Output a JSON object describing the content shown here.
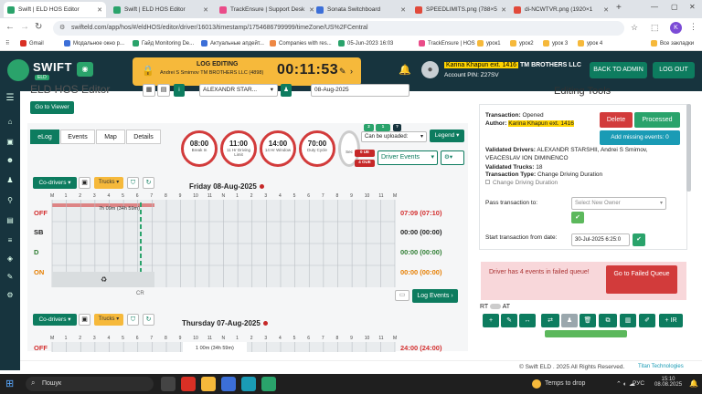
{
  "browser": {
    "tabs": [
      {
        "title": "Swift | ELD HOS Editor",
        "color": "#2aa36b"
      },
      {
        "title": "Swift | ELD HOS Editor",
        "color": "#2aa36b"
      },
      {
        "title": "TrackEnsure | Support Desk",
        "color": "#ea4c89"
      },
      {
        "title": "Sonata Switchboard",
        "color": "#3c6fd8"
      },
      {
        "title": "SPEEDLIMITS.png (788×5",
        "color": "#e14a3b"
      },
      {
        "title": "di-NCWTVR.png (1920×1",
        "color": "#e14a3b"
      }
    ],
    "url": "swifteld.com/app/hos/#/eldHOS/editor/driver/16013/timestamp/1754686799999/timeZone/US%2FCentral",
    "profile": "K",
    "bookmarks": [
      "Gmail",
      "Модальное окно р...",
      "Гайд Monitoring De...",
      "Актуальные апдейт...",
      "Companies with res...",
      "05-Jun-2023 16:03",
      "TrackEnsure | HOS",
      "урок1",
      "урок2",
      "урок 3",
      "урок 4",
      "Все закладки"
    ]
  },
  "header": {
    "logo": "SWIFT",
    "logo_sub": "ELD",
    "logging_title": "LOG EDITING",
    "logging_detail": "Andrei S Smirnov  TM BROTHERS LLC (4898)",
    "timer": "00:11:53",
    "author_name": "Karina Khapun ext. 1416",
    "company": "TM BROTHERS LLC",
    "account_pin": "Account PIN: Z27SV",
    "back_to_admin": "BACK TO ADMIN",
    "logout": "LOG OUT"
  },
  "editor": {
    "title": "ELD HOS Editor",
    "driver_select": "ALEXANDR STAR...",
    "date": "08-Aug-2025",
    "go_to_viewer": "Go to Viewer",
    "tabs": [
      "eLog",
      "Events",
      "Map",
      "Details"
    ],
    "clocks": [
      {
        "value": "08:00",
        "label": "Break In"
      },
      {
        "value": "11:00",
        "label": "11 Hr Driving Limit"
      },
      {
        "value": "14:00",
        "label": "14 Hr Window"
      },
      {
        "value": "70:00",
        "label": "Duty Cycle"
      }
    ],
    "clock_partial": "Sec",
    "badges": [
      "2",
      "1",
      "?",
      "0 UE",
      "4 OUE"
    ],
    "can_upload": "Can be uploaded:",
    "legend": "Legend",
    "driver_events": "Driver Events",
    "co_drivers": "Co-drivers",
    "trucks": "Trucks",
    "day1": {
      "title": "Friday 08-Aug-2025",
      "bar_label": "7h 09m (34h 59m)",
      "rows": [
        {
          "status": "OFF",
          "total": "07:09 (07:10)",
          "color": "#d32f2f"
        },
        {
          "status": "SB",
          "total": "00:00 (00:00)",
          "color": "#222"
        },
        {
          "status": "D",
          "total": "00:00 (00:00)",
          "color": "#2e7d32"
        },
        {
          "status": "ON",
          "total": "00:00 (00:00)",
          "color": "#e67e00"
        }
      ],
      "cr": "CR"
    },
    "log_events": "Log Events",
    "day2": {
      "title": "Thursday 07-Aug-2025",
      "bar_label": "1 00m (34h 59m)",
      "off": "OFF",
      "total": "24:00 (24:00)"
    },
    "hours": [
      "M",
      "1",
      "2",
      "3",
      "4",
      "5",
      "6",
      "7",
      "8",
      "9",
      "10",
      "11",
      "N",
      "1",
      "2",
      "3",
      "4",
      "5",
      "6",
      "7",
      "8",
      "9",
      "10",
      "11",
      "M"
    ]
  },
  "tools": {
    "title": "Editing Tools",
    "transaction_label": "Transaction:",
    "transaction_value": "Opened",
    "author_label": "Author:",
    "author_value": "Karina Khapun ext. 1416",
    "delete": "Delete",
    "processed": "Processed",
    "add_missing": "Add missing events: 0",
    "validated_drivers_label": "Validated Drivers:",
    "validated_drivers_value": "ALEXANDR STARSHII, Andrei S Smimov, VEACESLAV ION DIMINENCO",
    "validated_trucks_label": "Validated Trucks:",
    "validated_trucks_value": "18",
    "transaction_type_label": "Transaction Type:",
    "transaction_type_value": "Change Driving Duration",
    "checkbox_label": "Change Driving Duration",
    "pass_label": "Pass transaction to:",
    "pass_placeholder": "Select New Owner",
    "start_label": "Start transaction from date:",
    "start_value": "30-Jul-2025 6:25:0",
    "fail_text": "Driver has 4 events in failed queue!",
    "fail_btn": "Go to Failed Queue",
    "rt": "RT",
    "at": "AT",
    "ir": "+ IR"
  },
  "footer": {
    "copyright": "© Swift ELD . 2025 All Rights Reserved.",
    "powered": "Titan Technologies"
  },
  "taskbar": {
    "search": "Пошук",
    "weather": "Temps to drop",
    "lang": "РУС",
    "time": "15:10",
    "date": "08.08.2025"
  }
}
